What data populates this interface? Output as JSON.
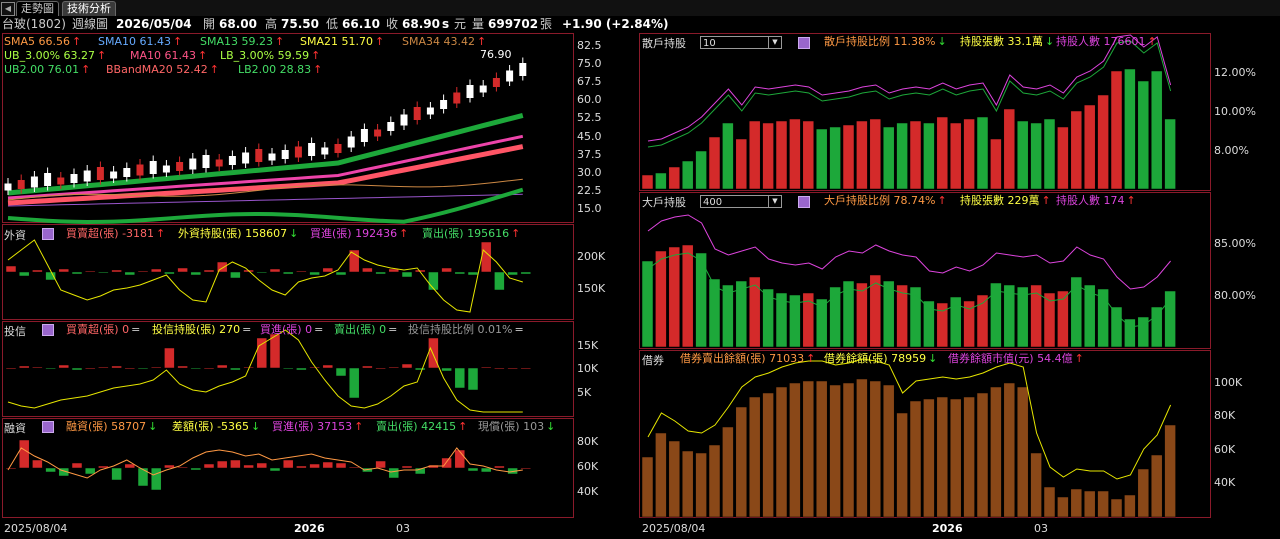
{
  "tabs": [
    {
      "label": "走勢圖"
    },
    {
      "label": "技術分析"
    }
  ],
  "header": {
    "stock": "台玻(1802)",
    "period": "週線圖",
    "date": "2026/05/04",
    "open_label": "開",
    "open": "68.00",
    "high_label": "高",
    "high": "75.50",
    "low_label": "低",
    "low": "66.10",
    "close_label": "收",
    "close": "68.90",
    "close_flag": "s",
    "currency": "元",
    "vol_label": "量",
    "volume": "699702",
    "vol_unit": "張",
    "change": "+1.90 (+2.84%)"
  },
  "colors": {
    "up": "#d42a2a",
    "down": "#1da83a",
    "frame": "#8a1a2a",
    "yellow": "#e6e600",
    "magenta": "#dd44dd",
    "orange": "#d08030"
  },
  "price_panel": {
    "legend": [
      {
        "text": "SMA5 66.56",
        "color": "#ff9944",
        "arrow": "↑"
      },
      {
        "text": "SMA10 61.43",
        "color": "#66aaff",
        "arrow": "↑"
      },
      {
        "text": "SMA13 59.23",
        "color": "#44dd66",
        "arrow": "↑"
      },
      {
        "text": "SMA21 51.70",
        "color": "#ffff44",
        "arrow": "↑"
      },
      {
        "text": "SMA34 43.42",
        "color": "#cc8844",
        "arrow": "↑"
      },
      {
        "text": "UB_3.00% 63.27",
        "color": "#aaff44",
        "arrow": "↑"
      },
      {
        "text": "MA10 61.43",
        "color": "#ff5588",
        "arrow": "↑"
      },
      {
        "text": "LB_3.00% 59.59",
        "color": "#aaff44",
        "arrow": "↑"
      },
      {
        "text": "UB2.00 76.01",
        "color": "#44dd66",
        "arrow": "↑"
      },
      {
        "text": "BBandMA20 52.42",
        "color": "#ff6666",
        "arrow": "↑"
      },
      {
        "text": "LB2.00 28.83",
        "color": "#44dd66",
        "arrow": "↑"
      }
    ],
    "peak_label": "76.90",
    "y_ticks": [
      "82.5",
      "75.0",
      "67.5",
      "60.0",
      "52.5",
      "45.0",
      "37.5",
      "30.0",
      "22.5",
      "15.0"
    ]
  },
  "foreign_panel": {
    "title": "外資",
    "legend": [
      {
        "text": "買賣超(張) -3181",
        "color": "#ff6666",
        "arrow": "↑"
      },
      {
        "text": "外資持股(張) 158607",
        "color": "#ffff44",
        "arrow": "↓"
      },
      {
        "text": "買進(張) 192436",
        "color": "#dd44dd",
        "arrow": "↑"
      },
      {
        "text": "賣出(張) 195616",
        "color": "#44dd66",
        "arrow": "↑"
      }
    ],
    "y_ticks": [
      "200K",
      "150K"
    ]
  },
  "trust_panel": {
    "title": "投信",
    "legend": [
      {
        "text": "買賣超(張) 0",
        "color": "#ff6666",
        "arrow": "="
      },
      {
        "text": "投信持股(張) 270",
        "color": "#ffff44",
        "arrow": "="
      },
      {
        "text": "買進(張) 0",
        "color": "#dd44dd",
        "arrow": "="
      },
      {
        "text": "賣出(張) 0",
        "color": "#44dd66",
        "arrow": "="
      },
      {
        "text": "投信持股比例 0.01%",
        "color": "#999999",
        "arrow": "="
      }
    ],
    "y_ticks": [
      "15K",
      "10K",
      "5K"
    ]
  },
  "margin_panel": {
    "title": "融資",
    "legend": [
      {
        "text": "融資(張) 58707",
        "color": "#ff9944",
        "arrow": "↓"
      },
      {
        "text": "差額(張) -5365",
        "color": "#ffff44",
        "arrow": "↓"
      },
      {
        "text": "買進(張) 37153",
        "color": "#dd44dd",
        "arrow": "↑"
      },
      {
        "text": "賣出(張) 42415",
        "color": "#44dd66",
        "arrow": "↑"
      },
      {
        "text": "現償(張) 103",
        "color": "#999999",
        "arrow": "↓"
      }
    ],
    "y_ticks": [
      "80K",
      "60K",
      "40K"
    ]
  },
  "left_x_axis": [
    "2025/08/04",
    "2026",
    "03"
  ],
  "retail_panel": {
    "title": "散戶持股",
    "select_value": "10",
    "legend": [
      {
        "text": "散戶持股比例 11.38%",
        "color": "#ff9944",
        "arrow": "↓"
      },
      {
        "text": "持股張數 33.1萬",
        "color": "#ffff44",
        "arrow": "↓"
      },
      {
        "text": "持股人數 176601",
        "color": "#dd44dd",
        "arrow": "↑"
      }
    ],
    "y_ticks": [
      "12.00%",
      "10.00%",
      "8.00%"
    ]
  },
  "major_panel": {
    "title": "大戶持股",
    "select_value": "400",
    "legend": [
      {
        "text": "大戶持股比例 78.74%",
        "color": "#ff9944",
        "arrow": "↑"
      },
      {
        "text": "持股張數 229萬",
        "color": "#ffff44",
        "arrow": "↑"
      },
      {
        "text": "持股人數 174",
        "color": "#dd44dd",
        "arrow": "↑"
      }
    ],
    "y_ticks": [
      "85.00%",
      "80.00%"
    ]
  },
  "lending_panel": {
    "title": "借券",
    "legend": [
      {
        "text": "借券賣出餘額(張) 71033",
        "color": "#ff9944",
        "arrow": "↑"
      },
      {
        "text": "借券餘額(張) 78959",
        "color": "#ffff44",
        "arrow": "↓"
      },
      {
        "text": "借券餘額市值(元) 54.4億",
        "color": "#dd44dd",
        "arrow": "↑"
      }
    ],
    "y_ticks": [
      "100K",
      "80K",
      "60K",
      "40K"
    ]
  },
  "right_x_axis": [
    "2025/08/04",
    "2026",
    "03"
  ]
}
